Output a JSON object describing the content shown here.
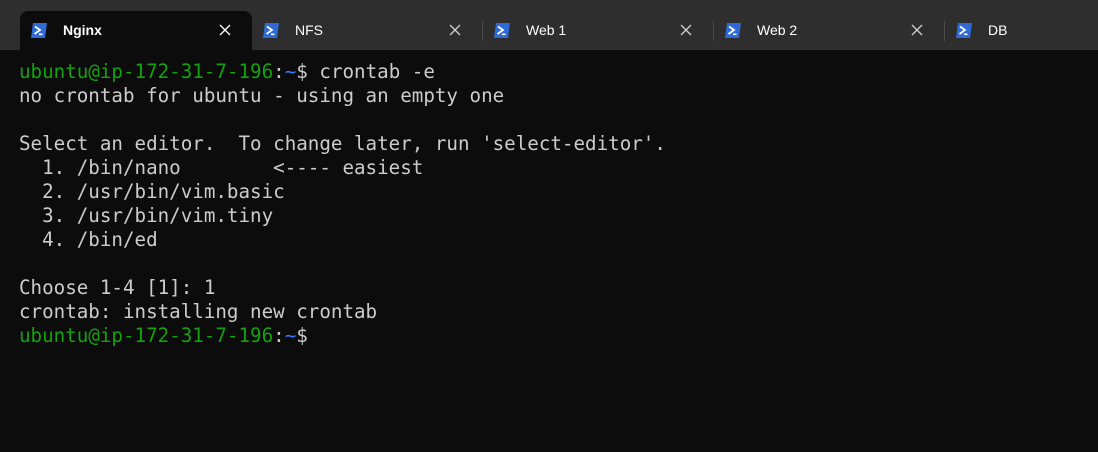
{
  "colors": {
    "tabbar_bg": "#2e2e2e",
    "terminal_bg": "#0c0c0c",
    "terminal_fg": "#cccccc",
    "prompt_user": "#13a10e",
    "prompt_path": "#3b78ff",
    "tab_icon_bg": "#2f6bd6"
  },
  "tabs": [
    {
      "label": "Nginx",
      "icon": "powershell-icon",
      "active": true
    },
    {
      "label": "NFS",
      "icon": "powershell-icon",
      "active": false
    },
    {
      "label": "Web 1",
      "icon": "powershell-icon",
      "active": false
    },
    {
      "label": "Web 2",
      "icon": "powershell-icon",
      "active": false
    },
    {
      "label": "DB",
      "icon": "powershell-icon",
      "active": false
    }
  ],
  "terminal": {
    "prompt_user": "ubuntu@ip-172-31-7-196",
    "prompt_sep": ":",
    "prompt_path": "~",
    "prompt_dollar": "$",
    "lines": [
      " crontab -e",
      "no crontab for ubuntu - using an empty one",
      "",
      "Select an editor.  To change later, run 'select-editor'.",
      "  1. /bin/nano        <---- easiest",
      "  2. /usr/bin/vim.basic",
      "  3. /usr/bin/vim.tiny",
      "  4. /bin/ed",
      "",
      "Choose 1-4 [1]: 1",
      "crontab: installing new crontab"
    ]
  }
}
